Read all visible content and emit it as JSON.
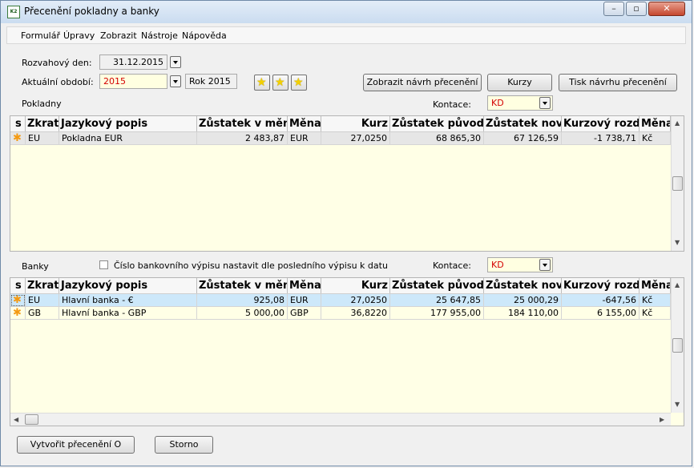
{
  "window": {
    "title": "Přecenění pokladny a banky",
    "icon_text": "K2"
  },
  "menu": [
    "Formulář",
    "Úpravy",
    "Zobrazit",
    "Nástroje",
    "Nápověda"
  ],
  "form": {
    "rozvahovy_den_label": "Rozvahový den:",
    "rozvahovy_den_value": "31.12.2015",
    "aktualni_obdobi_label": "Aktuální období:",
    "aktualni_obdobi_value": "2015",
    "obdobi_desc": "Rok 2015",
    "zobrazit_button": "Zobrazit návrh přecenění",
    "kurzy_button": "Kurzy",
    "tisk_button": "Tisk návrhu přecenění"
  },
  "pokladny": {
    "section_label": "Pokladny",
    "kontace_label": "Kontace:",
    "kontace_value": "KD",
    "columns": [
      "s",
      "Zkratka",
      "Jazykový popis",
      "Zůstatek v měně",
      "Měna",
      "Kurz",
      "Zůstatek původní",
      "Zůstatek nový",
      "Kurzový rozdíl",
      "Měna"
    ],
    "rows": [
      {
        "zkratka": "EU",
        "popis": "Pokladna EUR",
        "zustatek_mena": "2 483,87",
        "mena": "EUR",
        "kurz": "27,0250",
        "zustatek_puvodni": "68 865,30",
        "zustatek_novy": "67 126,59",
        "kurzovy_rozdil": "-1 738,71",
        "mena2": "Kč"
      }
    ]
  },
  "banky": {
    "section_label": "Banky",
    "checkbox_label": "Číslo bankovního výpisu nastavit dle posledního výpisu k datu",
    "kontace_label": "Kontace:",
    "kontace_value": "KD",
    "columns": [
      "s",
      "Zkratka",
      "Jazykový popis",
      "Zůstatek v měně",
      "Měna",
      "Kurz",
      "Zůstatek původní",
      "Zůstatek nový",
      "Kurzový rozdíl",
      "Měna"
    ],
    "rows": [
      {
        "zkratka": "EU",
        "popis": "Hlavní banka - €",
        "zustatek_mena": "925,08",
        "mena": "EUR",
        "kurz": "27,0250",
        "zustatek_puvodni": "25 647,85",
        "zustatek_novy": "25 000,29",
        "kurzovy_rozdil": "-647,56",
        "mena2": "Kč"
      },
      {
        "zkratka": "GB",
        "popis": "Hlavní banka - GBP",
        "zustatek_mena": "5 000,00",
        "mena": "GBP",
        "kurz": "36,8220",
        "zustatek_puvodni": "177 955,00",
        "zustatek_novy": "184 110,00",
        "kurzovy_rozdil": "6 155,00",
        "mena2": "Kč"
      }
    ]
  },
  "footer": {
    "vytvorit_button": "Vytvořit přecenění O",
    "storno_button": "Storno"
  },
  "colors": {
    "grid_bg": "#ffffe6",
    "selected_row": "#cde8fa",
    "red_value": "#d40000",
    "star": "#f49a12"
  }
}
